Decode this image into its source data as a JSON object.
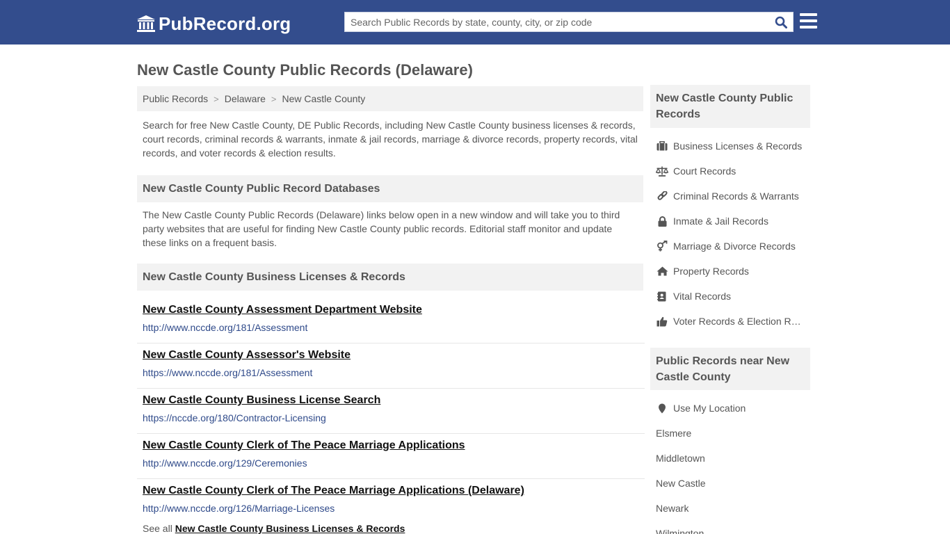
{
  "header": {
    "logo_text": "PubRecord.org",
    "search_placeholder": "Search Public Records by state, county, city, or zip code",
    "brand_color": "#334d8d"
  },
  "page": {
    "title": "New Castle County Public Records (Delaware)",
    "breadcrumb": [
      "Public Records",
      "Delaware",
      "New Castle County"
    ],
    "intro": "Search for free New Castle County, DE Public Records, including New Castle County business licenses & records, court records, criminal records & warrants, inmate & jail records, marriage & divorce records, property records, vital records, and voter records & election results.",
    "databases_heading": "New Castle County Public Record Databases",
    "databases_desc": "The New Castle County Public Records (Delaware) links below open in a new window and will take you to third party websites that are useful for finding New Castle County public records. Editorial staff monitor and update these links on a frequent basis.",
    "business_heading": "New Castle County Business Licenses & Records",
    "records": [
      {
        "title": "New Castle County Assessment Department Website",
        "url": "http://www.nccde.org/181/Assessment"
      },
      {
        "title": "New Castle County Assessor's Website",
        "url": "https://www.nccde.org/181/Assessment"
      },
      {
        "title": "New Castle County Business License Search",
        "url": "https://nccde.org/180/Contractor-Licensing"
      },
      {
        "title": "New Castle County Clerk of The Peace Marriage Applications",
        "url": "http://www.nccde.org/129/Ceremonies"
      },
      {
        "title": "New Castle County Clerk of The Peace Marriage Applications (Delaware)",
        "url": "http://www.nccde.org/126/Marriage-Licenses"
      }
    ],
    "see_all_prefix": "See all",
    "see_all_link": "New Castle County Business Licenses & Records"
  },
  "sidebar": {
    "categories_heading": "New Castle County Public Records",
    "categories": [
      {
        "label": "Business Licenses & Records",
        "icon": "briefcase-icon"
      },
      {
        "label": "Court Records",
        "icon": "scales-icon"
      },
      {
        "label": "Criminal Records & Warrants",
        "icon": "link-icon"
      },
      {
        "label": "Inmate & Jail Records",
        "icon": "lock-icon"
      },
      {
        "label": "Marriage & Divorce Records",
        "icon": "gender-icon"
      },
      {
        "label": "Property Records",
        "icon": "home-icon"
      },
      {
        "label": "Vital Records",
        "icon": "contact-book-icon"
      },
      {
        "label": "Voter Records & Election Results",
        "icon": "thumbs-up-icon"
      }
    ],
    "nearby_heading": "Public Records near New Castle County",
    "use_location": "Use My Location",
    "nearby": [
      "Elsmere",
      "Middletown",
      "New Castle",
      "Newark",
      "Wilmington"
    ]
  }
}
